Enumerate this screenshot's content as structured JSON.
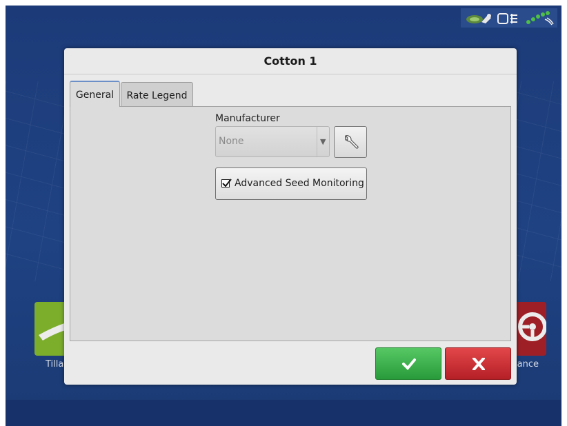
{
  "status_bar": {
    "icons": [
      "field-mapping-icon",
      "display-icon",
      "gps-signal-icon"
    ]
  },
  "background_apps": {
    "left_label": "Tilla",
    "right_label": "lance"
  },
  "dialog": {
    "title": "Cotton 1",
    "tabs": [
      {
        "label": "General",
        "selected": true
      },
      {
        "label": "Rate Legend",
        "selected": false
      }
    ],
    "manufacturer": {
      "label": "Manufacturer",
      "value": "None"
    },
    "advanced_seed_monitoring": {
      "label": "Advanced Seed Monitoring",
      "checked": true
    },
    "buttons": {
      "ok_icon": "checkmark-icon",
      "cancel_icon": "close-icon"
    }
  },
  "colors": {
    "background": "#1e3f7e",
    "ok": "#3aae48",
    "cancel": "#c8282e",
    "dialog": "#eaeaea"
  }
}
